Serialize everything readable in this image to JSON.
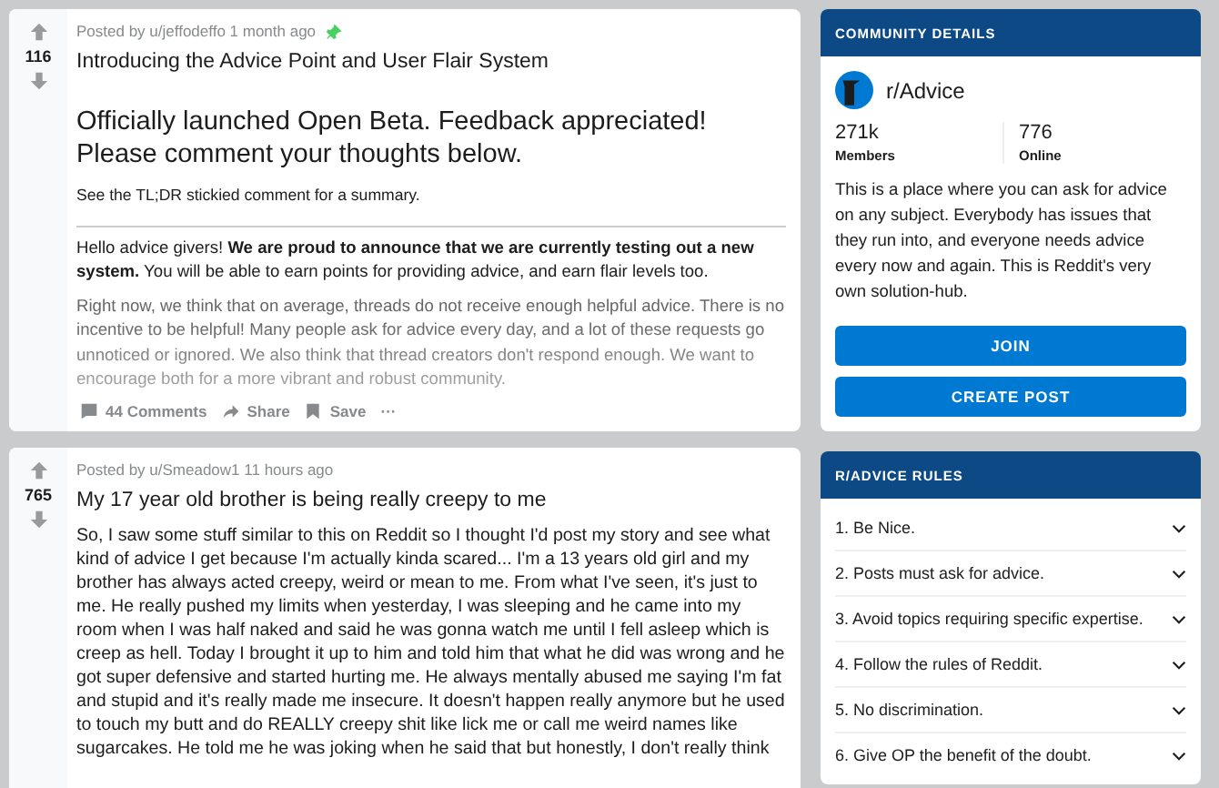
{
  "posts": [
    {
      "votes": "116",
      "posted_by": "Posted by u/jeffodeffo 1 month ago",
      "pinned": true,
      "title": "Introducing the Advice Point and User Flair System",
      "heading": "Officially launched Open Beta. Feedback appreciated! Please comment your thoughts below.",
      "paragraphs": [
        "See the TL;DR stickied comment for a summary.",
        "Hello advice givers! **We are proud to announce that we are currently testing out a new system.** You will be able to earn points for providing advice, and earn flair levels too.",
        "Right now, we think that on average, threads do not receive enough helpful advice. There is no incentive to be helpful! Many people ask for advice every day, and a lot of these requests go unnoticed or ignored. We also think that thread creators don't respond enough. We want to encourage both for a more vibrant and robust community."
      ],
      "truncated": true,
      "actions": [
        {
          "kind": "comments",
          "label": "44 Comments"
        },
        {
          "kind": "share",
          "label": "Share"
        },
        {
          "kind": "save",
          "label": "Save"
        },
        {
          "kind": "more",
          "label": "···"
        }
      ]
    },
    {
      "votes": "765",
      "posted_by": "Posted by u/Smeadow1 11 hours ago",
      "pinned": false,
      "title": "My 17 year old brother is being really creepy to me",
      "paragraphs": [
        "So, I saw some stuff similar to this on Reddit so I thought I'd post my story and see what kind of advice I get because I'm actually kinda scared... I'm a 13 years old girl and my brother has always acted creepy, weird or mean to me. From what I've seen, it's just to me. He really pushed my limits when yesterday, I was sleeping and he came into my room when I was half naked and said he was gonna watch me until I fell asleep which is creep as hell. Today I brought it up to him and told him that what he did was wrong and he got super defensive and started hurting me. He always mentally abused me saying I'm fat and stupid and it's really made me insecure. It doesn't happen really anymore but he used to touch my butt and do REALLY creepy shit like lick me or call me weird names like sugarcakes. He told me he was joking when he said that but honestly, I don't really think"
      ]
    }
  ],
  "community": {
    "header": "COMMUNITY DETAILS",
    "name": "r/Advice",
    "stats": [
      {
        "value": "271k",
        "label": "Members"
      },
      {
        "value": "776",
        "label": "Online"
      }
    ],
    "description": "This is a place where you can ask for advice on any subject. Everybody has issues that they run into, and everyone needs advice every now and again. This is Reddit's very own solution-hub.",
    "buttons": [
      "JOIN",
      "CREATE POST"
    ]
  },
  "rules": {
    "header": "R/ADVICE RULES",
    "items": [
      "1. Be Nice.",
      "2. Posts must ask for advice.",
      "3. Avoid topics requiring specific expertise.",
      "4. Follow the rules of Reddit.",
      "5. No discrimination.",
      "6. Give OP the benefit of the doubt."
    ]
  }
}
